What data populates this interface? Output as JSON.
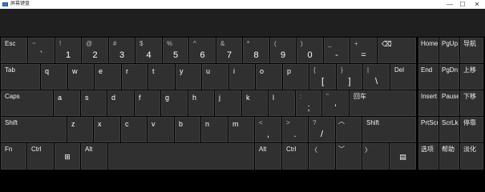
{
  "window": {
    "title": "屏幕键盘",
    "controls": {
      "minimize": "—",
      "maximize": "☐",
      "close": "✕"
    }
  },
  "keys": {
    "esc": "Esc",
    "tilde": {
      "shift": "~",
      "main": "`"
    },
    "d1": {
      "shift": "!",
      "main": "1"
    },
    "d2": {
      "shift": "@",
      "main": "2"
    },
    "d3": {
      "shift": "#",
      "main": "3"
    },
    "d4": {
      "shift": "$",
      "main": "4"
    },
    "d5": {
      "shift": "%",
      "main": "5"
    },
    "d6": {
      "shift": "^",
      "main": "6"
    },
    "d7": {
      "shift": "&",
      "main": "7"
    },
    "d8": {
      "shift": "*",
      "main": "8"
    },
    "d9": {
      "shift": "(",
      "main": "9"
    },
    "d0": {
      "shift": ")",
      "main": "0"
    },
    "minus": {
      "shift": "_",
      "main": "-"
    },
    "equal": {
      "shift": "+",
      "main": "="
    },
    "backspace": "⌫",
    "tab": "Tab",
    "q": "q",
    "w": "w",
    "e": "e",
    "r": "r",
    "t": "t",
    "y": "y",
    "u": "u",
    "i": "i",
    "o": "o",
    "p": "p",
    "lbracket": {
      "shift": "{",
      "main": "["
    },
    "rbracket": {
      "shift": "}",
      "main": "]"
    },
    "backslash": {
      "shift": "|",
      "main": "\\"
    },
    "del": "Del",
    "caps": "Caps",
    "a": "a",
    "s": "s",
    "d": "d",
    "f": "f",
    "g": "g",
    "h": "h",
    "j": "j",
    "k": "k",
    "l": "l",
    "semicolon": {
      "shift": ":",
      "main": ";"
    },
    "quote": {
      "shift": "\"",
      "main": "'"
    },
    "enter": "回车",
    "shift_left": "Shift",
    "z": "z",
    "x": "x",
    "c": "c",
    "v": "v",
    "b": "b",
    "n": "n",
    "m": "m",
    "comma": {
      "shift": "<",
      "main": ","
    },
    "period": {
      "shift": ">",
      "main": "."
    },
    "slash": {
      "shift": "?",
      "main": "/"
    },
    "up": "︿",
    "shift_right": "Shift",
    "fn": "Fn",
    "ctrl_left": "Ctrl",
    "win": "⊞",
    "alt_left": "Alt",
    "alt_right": "Alt",
    "ctrl_right": "Ctrl",
    "left": "〈",
    "down": "﹀",
    "right": "〉",
    "menu": "▤",
    "home": "Home",
    "pgup": "PgUp",
    "nav": "导航",
    "end": "End",
    "pgdn": "PgDn",
    "moveup": "上移",
    "insert": "Insert",
    "pause": "Pause",
    "movedown": "下移",
    "prtscn": "PrtScn",
    "scrlk": "ScrLk",
    "dock": "停靠",
    "options": "选项",
    "help": "帮助",
    "fade": "淡化"
  },
  "colors": {
    "key": "#303030",
    "background": "#000000",
    "titlebar": "#ffffff",
    "panel": "#1f1f1f"
  }
}
